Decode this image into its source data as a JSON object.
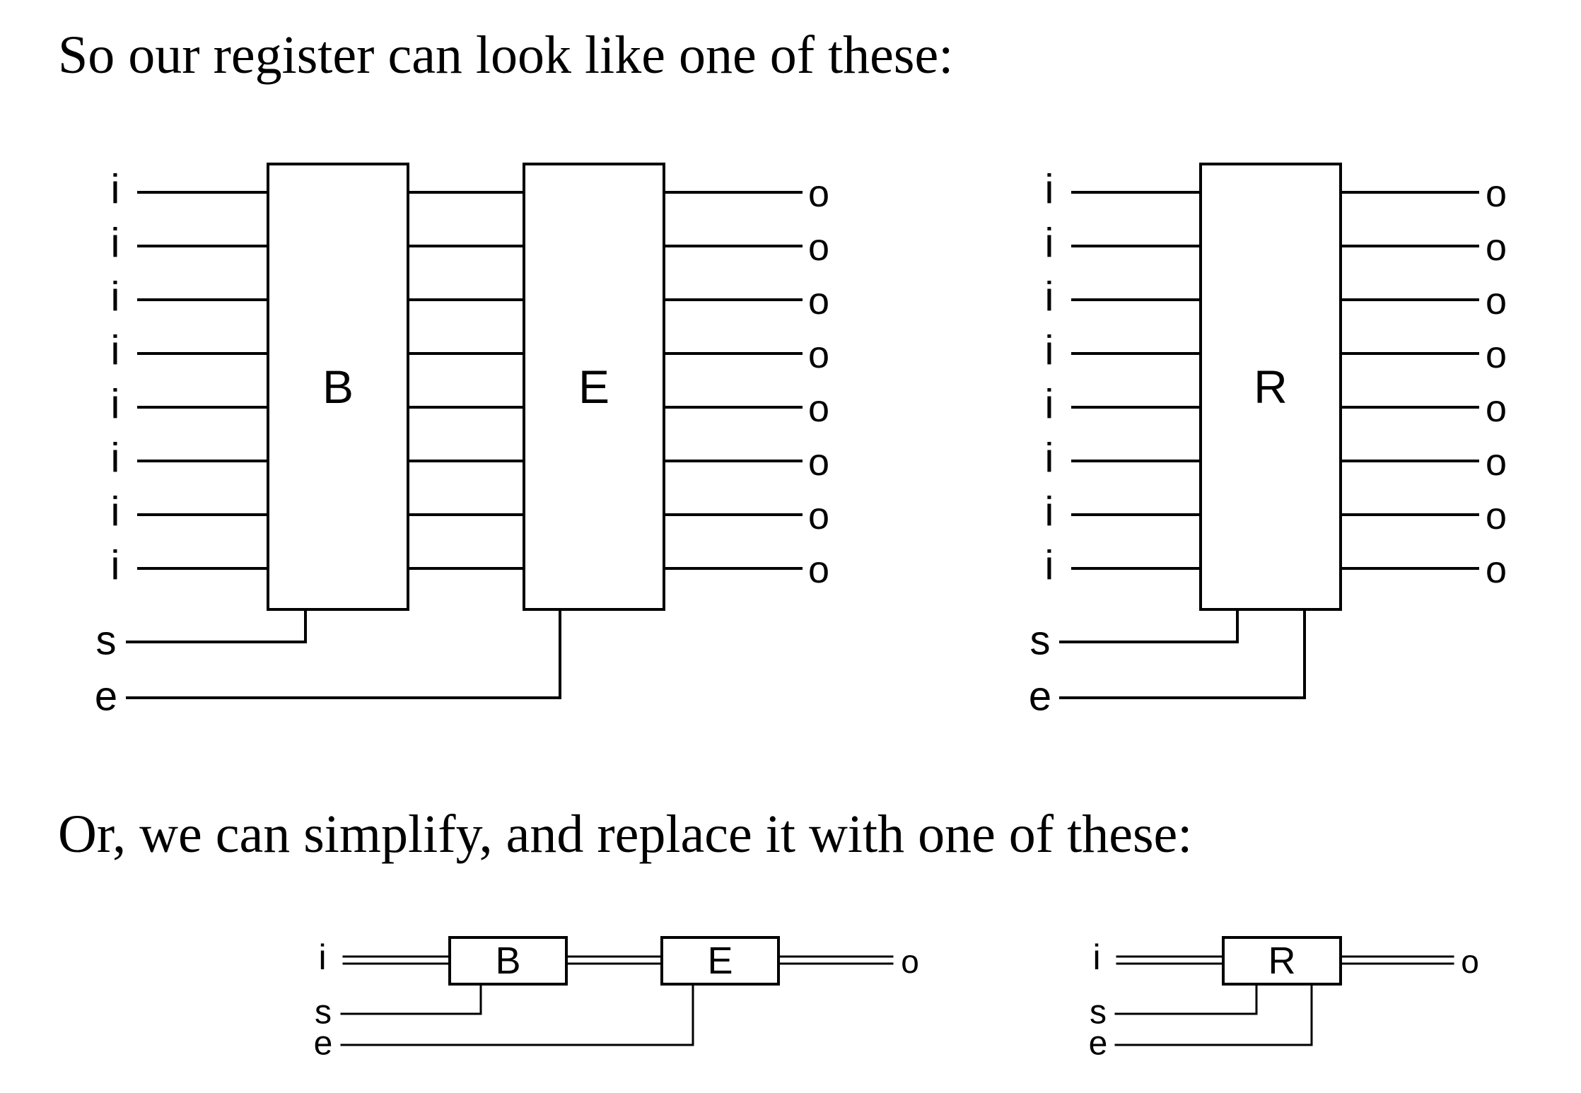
{
  "captions": {
    "first": "So our register can look like one of these:",
    "second": "Or, we can simplify, and replace it with one of these:"
  },
  "diagram": {
    "labels": {
      "input": "i",
      "output": "o",
      "set": "s",
      "enable": "e",
      "byte": "B",
      "enabler": "E",
      "register": "R"
    },
    "bits": 8
  }
}
